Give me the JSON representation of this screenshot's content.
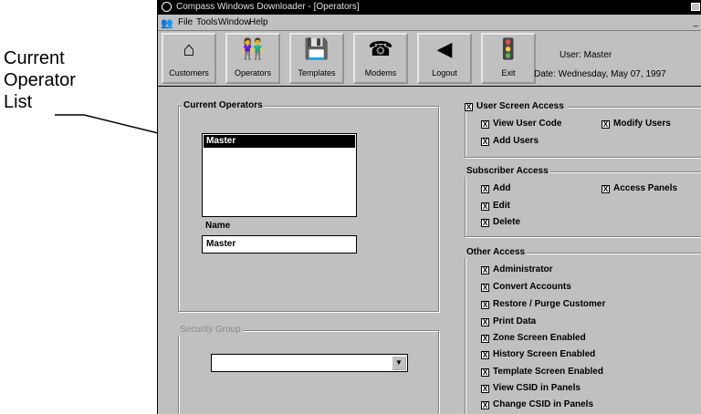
{
  "callout": {
    "line1": "Current",
    "line2": "Operator",
    "line3": "List"
  },
  "window": {
    "title": "Compass Windows Downloader - [Operators]"
  },
  "menu": {
    "file": "File",
    "tools": "Tools",
    "window": "Window",
    "help": "Help"
  },
  "toolbar": {
    "customers": "Customers",
    "operators": "Operators",
    "templates": "Templates",
    "modems": "Modems",
    "logout": "Logout",
    "exit": "Exit"
  },
  "user_info": {
    "user": "User: Master",
    "date": "Date: Wednesday, May 07, 1997"
  },
  "current_operators": {
    "title": "Current Operators",
    "items": [
      "Master"
    ],
    "name_label": "Name",
    "name_value": "Master"
  },
  "security_group": {
    "title": "Security Group",
    "value": ""
  },
  "user_screen_access": {
    "title": "User Screen Access",
    "view_user_code": "View User Code",
    "modify_users": "Modify Users",
    "add_users": "Add Users"
  },
  "subscriber_access": {
    "title": "Subscriber Access",
    "add": "Add",
    "access_panels": "Access Panels",
    "edit": "Edit",
    "delete": "Delete"
  },
  "other_access": {
    "title": "Other Access",
    "items": [
      "Administrator",
      "Convert Accounts",
      "Restore / Purge Customer",
      "Print Data",
      "Zone Screen Enabled",
      "History Screen Enabled",
      "Template Screen Enabled",
      "View CSID in Panels",
      "Change CSID in Panels"
    ]
  },
  "check_mark": "X"
}
